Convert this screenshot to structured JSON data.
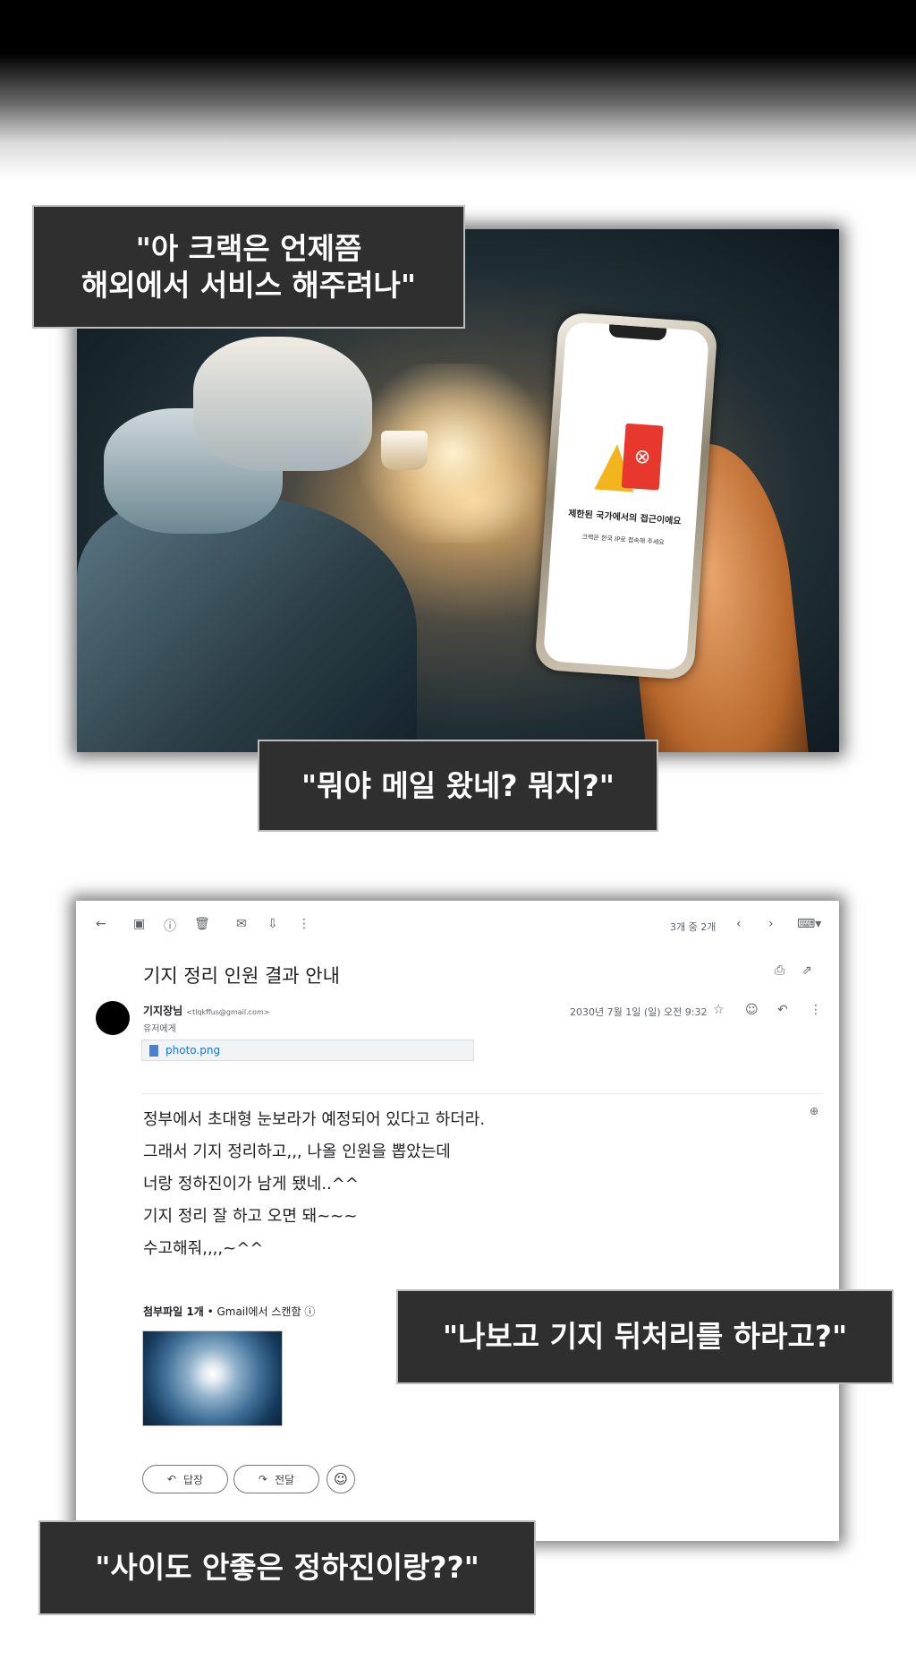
{
  "captions": {
    "c1_line1": "\"아 크랙은 언제쯤",
    "c1_line2": "해외에서 서비스 해주려나\"",
    "c2": "\"뭐야 메일 왔네? 뭐지?\"",
    "c3": "\"나보고 기지 뒤처리를 하라고?\"",
    "c4": "\"사이도 안좋은 정하진이랑??\""
  },
  "phone": {
    "title": "제한된 국가에서의 접근이에요",
    "subtitle": "크랙은 한국 IP로 접속해 주세요"
  },
  "email": {
    "pager": "3개 중 2개",
    "subject": "기지 정리 인원 결과 안내",
    "sender_name": "기지장님",
    "sender_email": "<tlqkffus@gmail.com>",
    "recipient": "유저에게",
    "date": "2030년 7월 1일 (일) 오전 9:32",
    "attachment_chip": "photo.png",
    "body": [
      "정부에서 초대형 눈보라가 예정되어 있다고 하더라.",
      "그래서 기지 정리하고,,, 나올 인원을 뽑았는데",
      "너랑 정하진이가 남게 됐네..^^",
      "기지 정리 잘 하고 오면 돼~~~",
      "수고해줘,,,,~^^"
    ],
    "attachments_label": "첨부파일 1개",
    "scanned_label": "• Gmail에서 스캔함",
    "reply_label": "답장",
    "forward_label": "전달"
  }
}
